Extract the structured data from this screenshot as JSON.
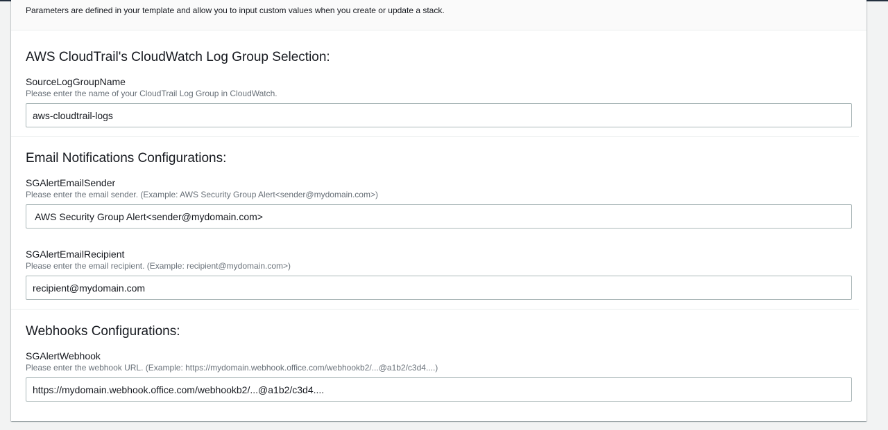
{
  "panel": {
    "description": "Parameters are defined in your template and allow you to input custom values when you create or update a stack."
  },
  "groups": [
    {
      "title": "AWS CloudTrail's CloudWatch Log Group Selection:",
      "fields": [
        {
          "label": "SourceLogGroupName",
          "description": "Please enter the name of your CloudTrail Log Group in CloudWatch.",
          "value": "aws-cloudtrail-logs"
        }
      ]
    },
    {
      "title": "Email Notifications Configurations:",
      "fields": [
        {
          "label": "SGAlertEmailSender",
          "description": "Please enter the email sender. (Example: AWS Security Group Alert<sender@mydomain.com>)",
          "value": " AWS Security Group Alert<sender@mydomain.com>"
        },
        {
          "label": "SGAlertEmailRecipient",
          "description": "Please enter the email recipient. (Example: recipient@mydomain.com>)",
          "value": "recipient@mydomain.com"
        }
      ]
    },
    {
      "title": "Webhooks Configurations:",
      "fields": [
        {
          "label": "SGAlertWebhook",
          "description": "Please enter the webhook URL. (Example: https://mydomain.webhook.office.com/webhookb2/...@a1b2/c3d4....)",
          "value": "https://mydomain.webhook.office.com/webhookb2/...@a1b2/c3d4...."
        }
      ]
    }
  ]
}
